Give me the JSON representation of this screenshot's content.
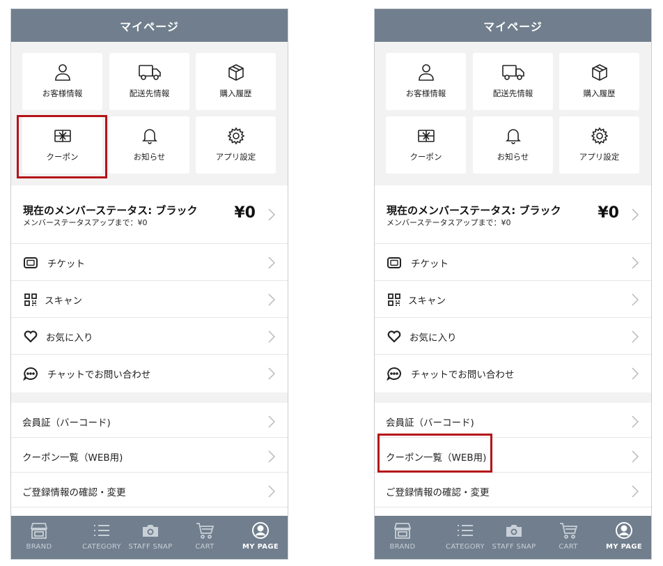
{
  "header": {
    "title": "マイページ"
  },
  "grid": [
    {
      "label": "お客様情報",
      "icon": "person-icon"
    },
    {
      "label": "配送先情報",
      "icon": "truck-icon"
    },
    {
      "label": "購入履歴",
      "icon": "box-icon"
    },
    {
      "label": "クーポン",
      "icon": "gift-icon"
    },
    {
      "label": "お知らせ",
      "icon": "bell-icon"
    },
    {
      "label": "アプリ設定",
      "icon": "gear-icon"
    }
  ],
  "member": {
    "title": "現在のメンバーステータス: ブラック",
    "subtitle": "メンバーステータスアップまで：¥0",
    "amount": "¥0"
  },
  "menu": [
    {
      "label": "チケット",
      "icon": "ticket-icon"
    },
    {
      "label": "スキャン",
      "icon": "qr-icon"
    },
    {
      "label": "お気に入り",
      "icon": "heart-icon"
    },
    {
      "label": "チャットでお問い合わせ",
      "icon": "chat-icon"
    }
  ],
  "links": [
    {
      "label": "会員証（バーコード)"
    },
    {
      "label": "クーポン一覧（WEB用)"
    },
    {
      "label": "ご登録情報の確認・変更"
    }
  ],
  "tabs": [
    {
      "label": "BRAND",
      "icon": "store-icon",
      "active": false
    },
    {
      "label": "CATEGORY",
      "icon": "list-icon",
      "active": false
    },
    {
      "label": "STAFF SNAP",
      "icon": "camera-icon",
      "active": false
    },
    {
      "label": "CART",
      "icon": "cart-icon",
      "active": false
    },
    {
      "label": "MY PAGE",
      "icon": "account-icon",
      "active": true
    }
  ],
  "colors": {
    "header": "#707e8d",
    "highlight": "#b41319",
    "background": "#f2f2f2"
  }
}
